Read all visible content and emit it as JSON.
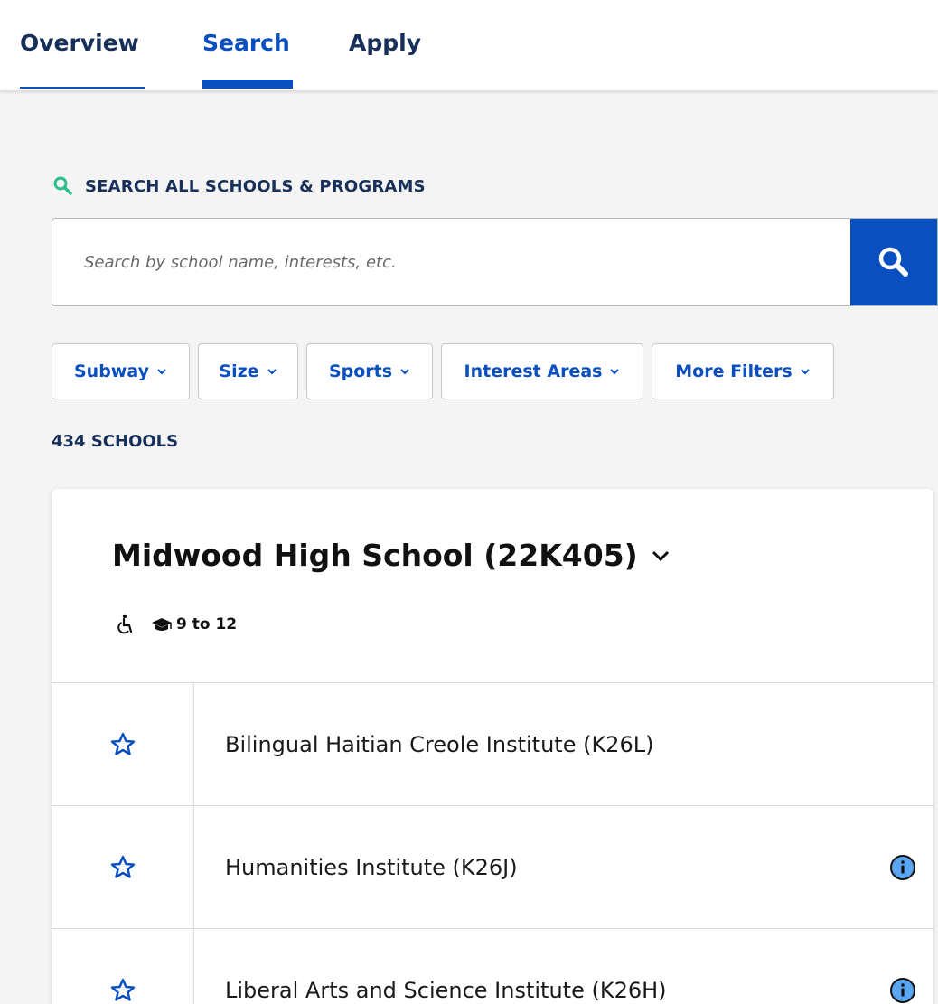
{
  "tabs": [
    {
      "label": "Overview"
    },
    {
      "label": "Search"
    },
    {
      "label": "Apply"
    }
  ],
  "search": {
    "heading": "SEARCH ALL SCHOOLS & PROGRAMS",
    "placeholder": "Search by school name, interests, etc.",
    "value": ""
  },
  "filters": [
    {
      "label": "Subway"
    },
    {
      "label": "Size"
    },
    {
      "label": "Sports"
    },
    {
      "label": "Interest Areas"
    },
    {
      "label": "More Filters"
    }
  ],
  "results": {
    "count_label": "434 SCHOOLS"
  },
  "school": {
    "title": "Midwood High School (22K405)",
    "grades": "9 to 12",
    "programs": [
      {
        "name": "Bilingual Haitian Creole Institute (K26L)",
        "has_info": false
      },
      {
        "name": "Humanities Institute (K26J)",
        "has_info": true
      },
      {
        "name": "Liberal Arts and Science Institute (K26H)",
        "has_info": true
      }
    ]
  },
  "colors": {
    "accent": "#0a4fbf",
    "heading": "#17305a",
    "search_icon_green": "#2bbf8a",
    "info_icon": "#5aa6f0"
  },
  "icons": {
    "search_heading": "search-icon",
    "search_button": "search-icon",
    "filter_chevron": "chevron-down-icon",
    "title_chevron": "chevron-down-icon",
    "accessibility": "wheelchair-icon",
    "grades": "graduation-cap-icon",
    "favorite": "star-outline-icon",
    "info": "info-icon"
  }
}
